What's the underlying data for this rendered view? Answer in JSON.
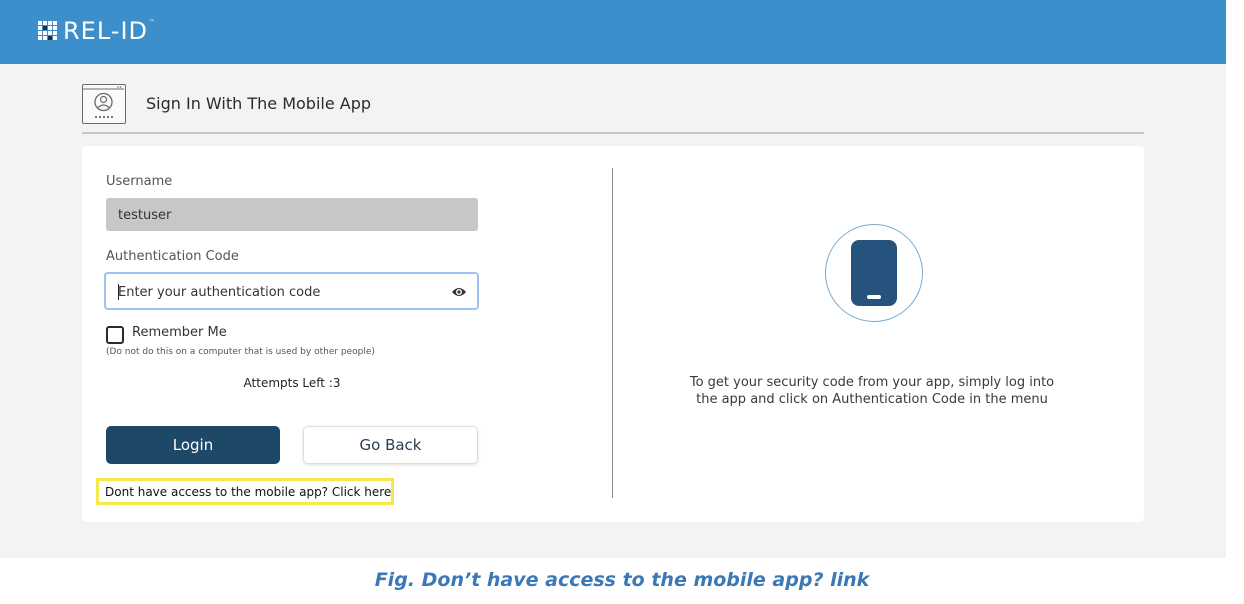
{
  "brand": {
    "logo_text": "REL-ID",
    "trademark": "™"
  },
  "header": {
    "title": "Sign In With The Mobile App",
    "icon": "user-badge-icon"
  },
  "form": {
    "username_label": "Username",
    "username_value": "testuser",
    "auth_code_label": "Authentication Code",
    "auth_code_placeholder": "Enter your authentication code",
    "remember_label": "Remember Me",
    "remember_checked": false,
    "remember_hint": "(Do not do this on a computer that is used by other people)",
    "attempts_text": "Attempts Left :3",
    "login_label": "Login",
    "back_label": "Go Back",
    "no_access_link": "Dont have access to the mobile app? Click here"
  },
  "info": {
    "icon": "mobile-phone-icon",
    "line1": "To get your security code from your app, simply log into",
    "line2": "the app and click on Authentication Code in the menu"
  },
  "caption": "Fig. Don’t have access to the mobile app? link",
  "colors": {
    "topbar": "#3d8fcb",
    "login_button": "#1d4868",
    "highlight": "#f7e84a",
    "caption": "#3a78b7"
  }
}
